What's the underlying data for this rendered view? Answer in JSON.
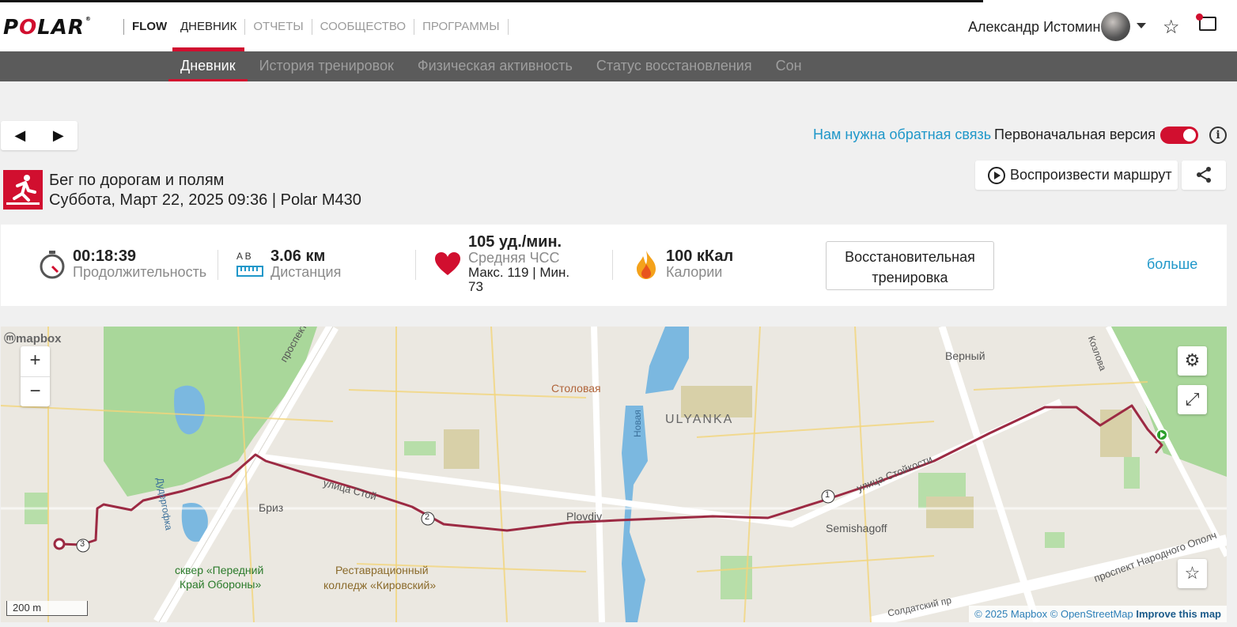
{
  "header": {
    "brand_flow": "FLOW",
    "nav": [
      "ДНЕВНИК",
      "ОТЧЕТЫ",
      "СООБЩЕСТВО",
      "ПРОГРАММЫ"
    ],
    "active_nav": "ДНЕВНИК",
    "user_name": "Александр Истомин"
  },
  "subnav": {
    "items": [
      "Дневник",
      "История тренировок",
      "Физическая активность",
      "Статус восстановления",
      "Сон"
    ],
    "active": "Дневник"
  },
  "controls": {
    "prev_glyph": "◀",
    "next_glyph": "▶",
    "feedback_link": "Нам нужна обратная связь",
    "original_version_label": "Первоначальная версия",
    "original_version_on": true,
    "info_glyph": "i"
  },
  "session": {
    "sport_name": "Бег по дорогам и полям",
    "date_line": "Суббота, Март 22, 2025 09:36 | Polar M430",
    "replay_button": "Воспроизвести маршрут"
  },
  "stats": {
    "duration_value": "00:18:39",
    "duration_label": "Продолжительность",
    "distance_ab": "A   B",
    "distance_value": "3.06 км",
    "distance_label": "Дистанция",
    "hr_value": "105 уд./мин.",
    "hr_label": "Средняя ЧСС",
    "hr_minmax_1": "Макс. 119  |  Мин.",
    "hr_minmax_2": "73",
    "calories_value": "100 кКал",
    "calories_label": "Калории",
    "recovery_button_1": "Восстановительная",
    "recovery_button_2": "тренировка",
    "more_link": "больше"
  },
  "map": {
    "mapbox_logo": "mapbox",
    "scale_label": "200 m",
    "attribution_mapbox": "© 2025 Mapbox",
    "attribution_osm": "© OpenStreetMap",
    "improve_link": "Improve this map",
    "labels": {
      "stolovaya": "Столовая",
      "ulyanka": "ULYANKA",
      "verny": "Верный",
      "briz": "Бриз",
      "plovdiv": "Plovdiv",
      "semishagoff": "Semishagoff",
      "college_1": "Реставрационный",
      "college_2": "колледж «Кировский»",
      "square_1": "сквер «Передний",
      "square_2": "Край Обороны»",
      "prospekt_mars": "проспект Ма",
      "ulitsa_stoikosti": "улица Стойкости",
      "ulitsa_st2": "улица Стой",
      "prospekt_nar": "проспект Народного Ополч",
      "kozlova": "Козлова",
      "novaya": "Новая",
      "dudergofka": "Дудергофка",
      "sol_prospekt": "Солдатский пр"
    },
    "km_markers": [
      "1",
      "2",
      "3"
    ],
    "route_color": "#9c2a43"
  },
  "colors": {
    "brand_red": "#d10f2f",
    "link_blue": "#1f97c9",
    "subnav_bg": "#5b5b5b"
  }
}
